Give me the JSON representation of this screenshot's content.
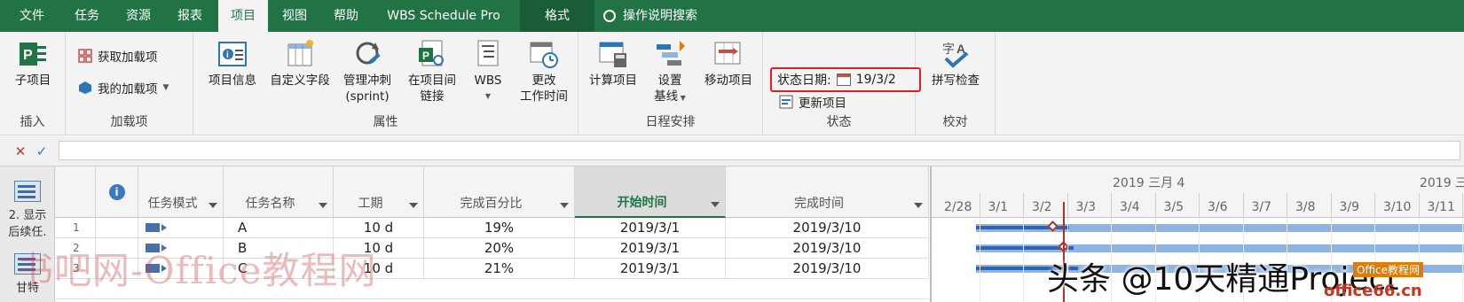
{
  "ribbon_tabs": [
    "文件",
    "任务",
    "资源",
    "报表",
    "项目",
    "视图",
    "帮助",
    "WBS Schedule Pro",
    "格式"
  ],
  "search_label": "操作说明搜索",
  "groups": {
    "insert": {
      "label": "插入",
      "subproject": "子项目"
    },
    "addins": {
      "label": "加载项",
      "get_addins": "获取加载项",
      "my_addins": "我的加载项"
    },
    "properties": {
      "label": "属性",
      "project_info": "项目信息",
      "custom_fields": "自定义字段",
      "sprint_l1": "管理冲刺",
      "sprint_l2": "(sprint)",
      "links_l1": "在项目间",
      "links_l2": "链接",
      "wbs": "WBS",
      "worktime_l1": "更改",
      "worktime_l2": "工作时间"
    },
    "schedule": {
      "label": "日程安排",
      "calc": "计算项目",
      "baseline_l1": "设置",
      "baseline_l2": "基线",
      "move": "移动项目"
    },
    "status": {
      "label": "状态",
      "status_date_label": "状态日期:",
      "status_date_value": "19/3/2",
      "update": "更新项目"
    },
    "proofing": {
      "label": "校对",
      "spell": "拼写检查"
    }
  },
  "formula_bar": {
    "cancel": "✕",
    "enter": "✓",
    "value": ""
  },
  "views": [
    {
      "label_l1": "2. 显示",
      "label_l2": "后续任."
    },
    {
      "label_l1": "甘特"
    }
  ],
  "columns": [
    {
      "label": "i"
    },
    {
      "label": "任务模式"
    },
    {
      "label": "任务名称"
    },
    {
      "label": "工期"
    },
    {
      "label": "完成百分比"
    },
    {
      "label": "开始时间"
    },
    {
      "label": "完成时间"
    }
  ],
  "rows": [
    {
      "num": "1",
      "name": "A",
      "duration": "10 d",
      "percent": "19%",
      "start": "2019/3/1",
      "finish": "2019/3/10"
    },
    {
      "num": "2",
      "name": "B",
      "duration": "10 d",
      "percent": "20%",
      "start": "2019/3/1",
      "finish": "2019/3/10"
    },
    {
      "num": "3",
      "name": "C",
      "duration": "10 d",
      "percent": "21%",
      "start": "2019/3/1",
      "finish": "2019/3/10"
    }
  ],
  "timescale": {
    "major": [
      "2019 三月 4",
      "2019 三"
    ],
    "minor": [
      "2/28",
      "3/1",
      "3/2",
      "3/3",
      "3/4",
      "3/5",
      "3/6",
      "3/7",
      "3/8",
      "3/9",
      "3/10",
      "3/11"
    ]
  },
  "watermarks": {
    "left": "书吧网-Office教程网",
    "right": "头条 @10天精通Project",
    "logo": "office66.cn",
    "logo_small": "Office教程网"
  },
  "colors": {
    "ribbon_green": "#217346",
    "status_line": "#b03030",
    "bar": "#8db4e2",
    "progress": "#2f63b0"
  }
}
